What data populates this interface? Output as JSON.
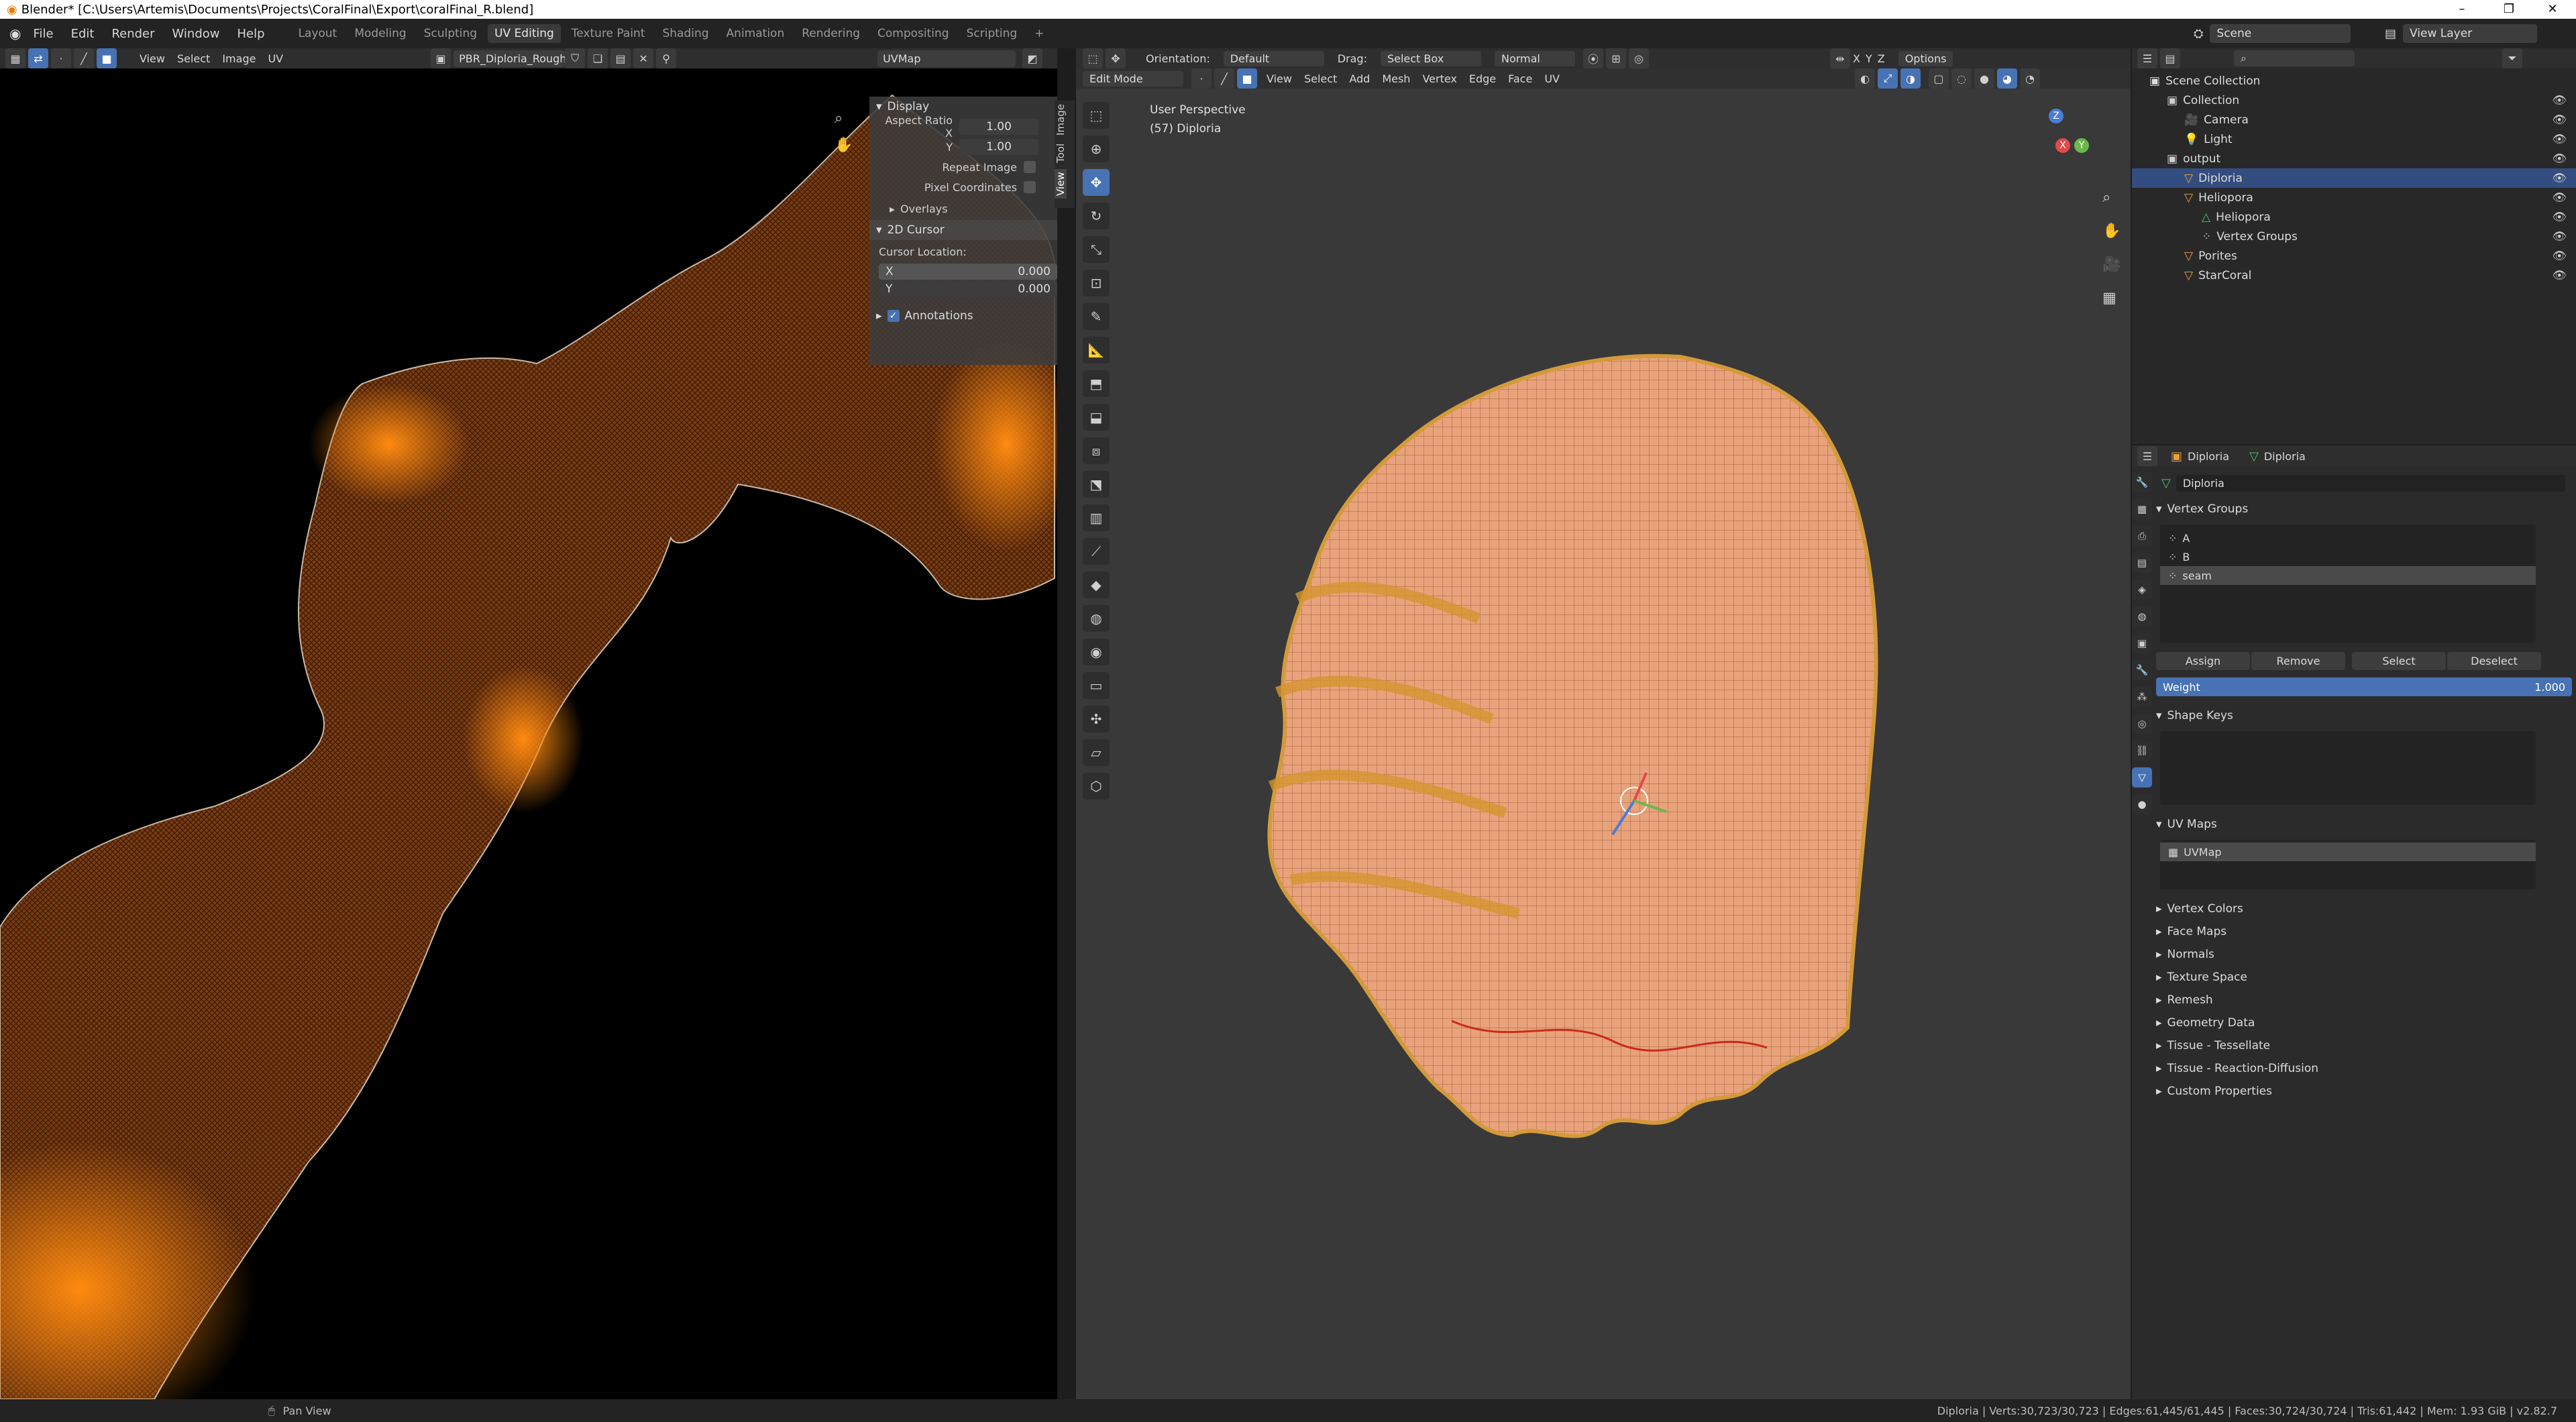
{
  "window": {
    "title": "Blender* [C:\\Users\\Artemis\\Documents\\Projects\\CoralFinal\\Export\\coralFinal_R.blend]",
    "min": "–",
    "max": "❐",
    "close": "✕"
  },
  "menu": [
    "File",
    "Edit",
    "Render",
    "Window",
    "Help"
  ],
  "workspaces": [
    "Layout",
    "Modeling",
    "Sculpting",
    "UV Editing",
    "Texture Paint",
    "Shading",
    "Animation",
    "Rendering",
    "Compositing",
    "Scripting",
    "+"
  ],
  "scene": {
    "label": "Scene",
    "view_layer": "View Layer"
  },
  "uv_editor": {
    "menus": [
      "View",
      "Select",
      "Image",
      "UV"
    ],
    "image_name": "PBR_Diploria_Rough...",
    "uvmap_name": "UVMap",
    "tabs": [
      "Image",
      "Tool",
      "View"
    ],
    "display": {
      "header": "Display",
      "aspect_x_label": "Aspect Ratio X",
      "aspect_x": "1.00",
      "aspect_y_label": "Y",
      "aspect_y": "1.00",
      "repeat_image": "Repeat Image",
      "pixel_coords": "Pixel Coordinates",
      "overlays": "Overlays"
    },
    "cursor": {
      "header": "2D Cursor",
      "location_label": "Cursor Location:",
      "x_label": "X",
      "x": "0.000",
      "y_label": "Y",
      "y": "0.000"
    },
    "annotations": "Annotations"
  },
  "viewport": {
    "mode": "Edit Mode",
    "menus": [
      "View",
      "Select",
      "Add",
      "Mesh",
      "Vertex",
      "Edge",
      "Face",
      "UV"
    ],
    "orientation_label": "Orientation:",
    "orientation": "Default",
    "drag_label": "Drag:",
    "drag": "Select Box",
    "pivot": "Normal",
    "options": "Options",
    "xyz": [
      "X",
      "Y",
      "Z"
    ],
    "perspective": "User Perspective",
    "object_label": "(57) Diploria",
    "gizmo": {
      "x": "X",
      "y": "Y",
      "z": "Z"
    }
  },
  "outliner": {
    "root": "Scene Collection",
    "items": [
      {
        "name": "Collection",
        "indent": 1,
        "icon": "collection-icon"
      },
      {
        "name": "Camera",
        "indent": 2,
        "icon": "camera-icon"
      },
      {
        "name": "Light",
        "indent": 2,
        "icon": "light-icon"
      },
      {
        "name": "output",
        "indent": 1,
        "icon": "collection-icon"
      },
      {
        "name": "Diploria",
        "indent": 2,
        "icon": "mesh-icon",
        "selected": true
      },
      {
        "name": "Heliopora",
        "indent": 2,
        "icon": "mesh-icon"
      },
      {
        "name": "Heliopora",
        "indent": 3,
        "icon": "mesh-data-icon"
      },
      {
        "name": "Vertex Groups",
        "indent": 3,
        "icon": "vertex-groups-icon"
      },
      {
        "name": "Porites",
        "indent": 2,
        "icon": "mesh-icon"
      },
      {
        "name": "StarCoral",
        "indent": 2,
        "icon": "mesh-icon"
      }
    ]
  },
  "properties": {
    "crumb_object": "Diploria",
    "crumb_data": "Diploria",
    "data_name": "Diploria",
    "vertex_groups": {
      "header": "Vertex Groups",
      "groups": [
        "A",
        "B",
        "seam"
      ],
      "assign": "Assign",
      "remove": "Remove",
      "select": "Select",
      "deselect": "Deselect",
      "weight_label": "Weight",
      "weight": "1.000"
    },
    "shape_keys": "Shape Keys",
    "uv_maps": {
      "header": "UV Maps",
      "items": [
        "UVMap"
      ]
    },
    "collapsed": [
      "Vertex Colors",
      "Face Maps",
      "Normals",
      "Texture Space",
      "Remesh",
      "Geometry Data",
      "Tissue - Tessellate",
      "Tissue - Reaction-Diffusion",
      "Custom Properties"
    ]
  },
  "status": {
    "left": "Pan View",
    "right": "Diploria | Verts:30,723/30,723 | Edges:61,445/61,445 | Faces:30,724/30,724 | Tris:61,442 | Mem: 1.93 GiB | v2.82.7"
  }
}
